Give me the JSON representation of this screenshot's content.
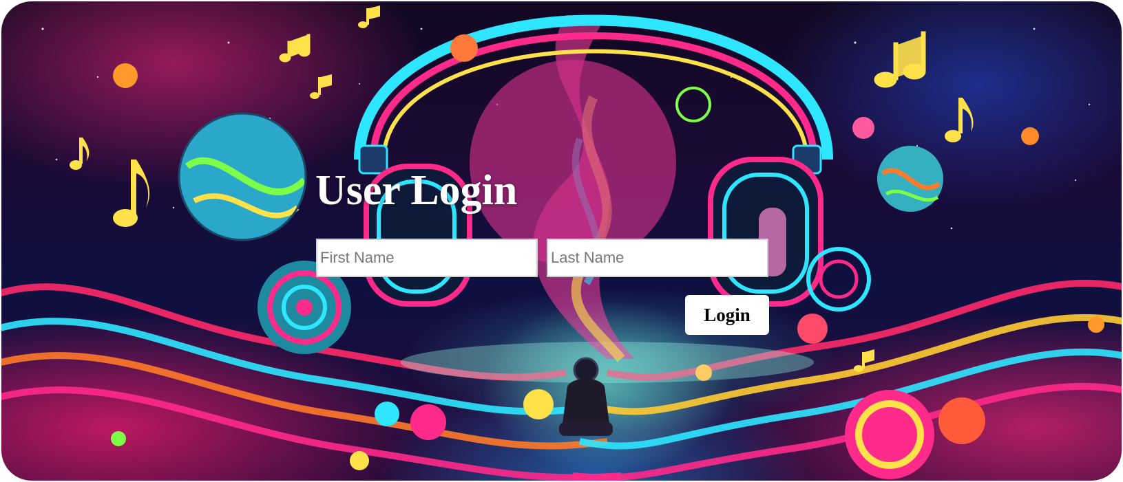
{
  "login": {
    "title": "User Login",
    "first_name_placeholder": "First Name",
    "last_name_placeholder": "Last Name",
    "first_name_value": "",
    "last_name_value": "",
    "submit_label": "Login"
  },
  "background": {
    "icons": [
      "headphones-icon",
      "planet-icon",
      "music-note-icon",
      "astronaut-icon"
    ]
  },
  "colors": {
    "accent_pink": "#ff2a8a",
    "accent_cyan": "#2ee6ff",
    "accent_yellow": "#ffe14a",
    "accent_green": "#7dff4a",
    "night_sky": "#140a2a"
  }
}
